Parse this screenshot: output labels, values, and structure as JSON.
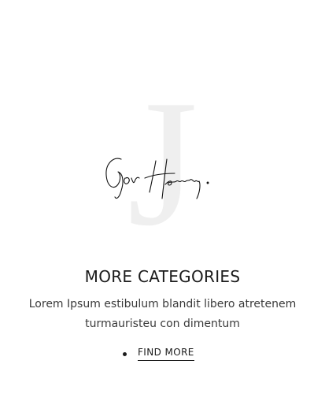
{
  "hero": {
    "watermark_letter": "J",
    "signature_text": "Gov Hereny.",
    "watermark_color": "#efefef",
    "signature_color": "#111111"
  },
  "section": {
    "title": "MORE CATEGORIES",
    "description": "Lorem Ipsum estibulum blandit libero atretenem turmauristeu con dimentum"
  },
  "cta": {
    "label": "FIND MORE",
    "bullet_icon": "dot-icon"
  }
}
